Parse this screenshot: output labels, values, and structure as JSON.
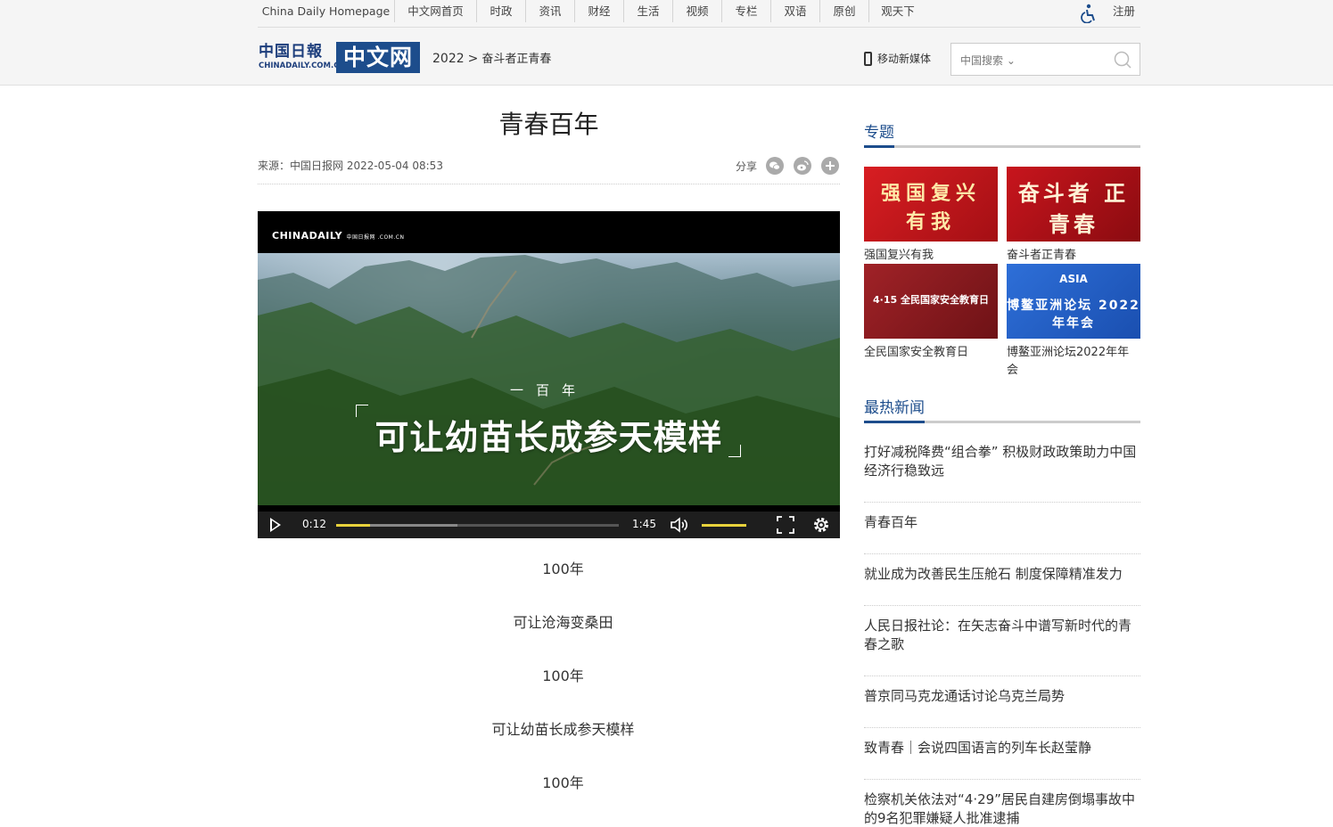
{
  "topnav": {
    "items": [
      "China Daily Homepage",
      "中文网首页",
      "时政",
      "资讯",
      "财经",
      "生活",
      "视频",
      "专栏",
      "双语",
      "原创",
      "观天下"
    ],
    "register": "注册"
  },
  "logo": {
    "cn": "中国日報",
    "en": "CHINADAILY.COM.CN",
    "big": "中文网"
  },
  "breadcrumb": {
    "year": "2022",
    "sep": ">",
    "current": "奋斗者正青春"
  },
  "header": {
    "mobile": "移动新媒体",
    "search_scope": "中国搜索",
    "search_placeholder": ""
  },
  "article": {
    "title": "青春百年",
    "source": "来源：中国日报网 2022-05-04 08:53",
    "share": "分享",
    "lines": [
      "100年",
      "可让沧海变桑田",
      "100年",
      "可让幼苗长成参天模样",
      "100年"
    ]
  },
  "video": {
    "logo": "CHINADAILY",
    "logo_small": "中国日报网 .COM.CN",
    "caption_small": "一百年",
    "caption_big": "可让幼苗长成参天模样",
    "current_time": "0:12",
    "duration": "1:45",
    "played_fraction": 0.12,
    "buffered_fraction": 0.43,
    "volume_fraction": 1.0
  },
  "sidebar": {
    "topics_title": "专题",
    "topics": [
      {
        "label": "强国复兴有我",
        "art": "强国复兴 有我",
        "color": "#c8151d"
      },
      {
        "label": "奋斗者正青春",
        "art": "奋斗者 正青春",
        "color": "#b8121a"
      },
      {
        "label": "全民国家安全教育日",
        "art": "4·15 全民国家安全教育日",
        "color": "#8e1b1f"
      },
      {
        "label": "博鳌亚洲论坛2022年年会",
        "art": "博鳌亚洲论坛 2022年年会",
        "color": "#2462c8"
      }
    ],
    "hot_title": "最热新闻",
    "hot": [
      "打好减税降费“组合拳” 积极财政政策助力中国经济行稳致远",
      "青春百年",
      "就业成为改善民生压舱石 制度保障精准发力",
      "人民日报社论：在矢志奋斗中谱写新时代的青春之歌",
      "普京同马克龙通话讨论乌克兰局势",
      "致青春｜会说四国语言的列车长赵莹静",
      "检察机关依法对“4·29”居民自建房倒塌事故中的9名犯罪嫌疑人批准逮捕"
    ]
  },
  "colors": {
    "brand_blue": "#1d4d8c",
    "progress_yellow": "#e8d23c"
  }
}
